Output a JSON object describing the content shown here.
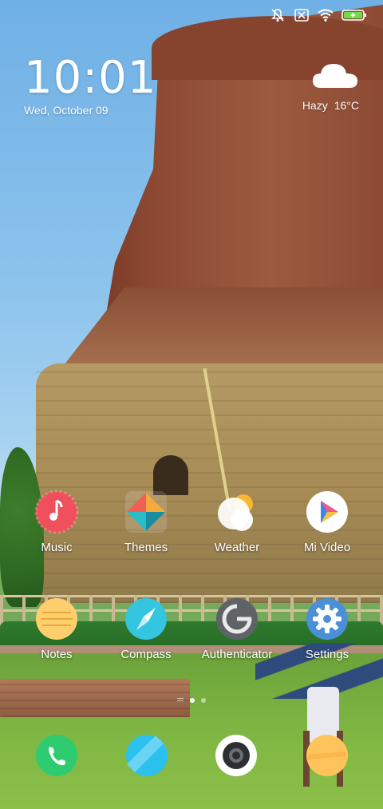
{
  "status_bar": {
    "icons": [
      "mute-bell-icon",
      "no-sim-icon",
      "wifi-icon",
      "battery-charging-icon"
    ]
  },
  "clock": {
    "time": "10:01",
    "date": "Wed, October 09"
  },
  "weather": {
    "icon": "cloud-icon",
    "condition": "Hazy",
    "temperature": "16°C"
  },
  "apps": [
    {
      "label": "Music",
      "icon": "music-icon"
    },
    {
      "label": "Themes",
      "icon": "themes-icon"
    },
    {
      "label": "Weather",
      "icon": "weather-icon"
    },
    {
      "label": "Mi Video",
      "icon": "video-play-icon"
    },
    {
      "label": "Notes",
      "icon": "notes-icon"
    },
    {
      "label": "Compass",
      "icon": "compass-icon"
    },
    {
      "label": "Authenticator",
      "icon": "authenticator-icon"
    },
    {
      "label": "Settings",
      "icon": "gear-icon"
    }
  ],
  "dock": [
    {
      "icon": "phone-icon"
    },
    {
      "icon": "messages-icon"
    },
    {
      "icon": "camera-icon"
    },
    {
      "icon": "browser-icon"
    }
  ],
  "page_indicator": {
    "count": 2,
    "active": 1
  },
  "colors": {
    "music": "#f0505c",
    "compass": "#34c6e0",
    "phone": "#2ecc71",
    "notes": "#ffcf6e",
    "settings": "#4a8fd8"
  }
}
